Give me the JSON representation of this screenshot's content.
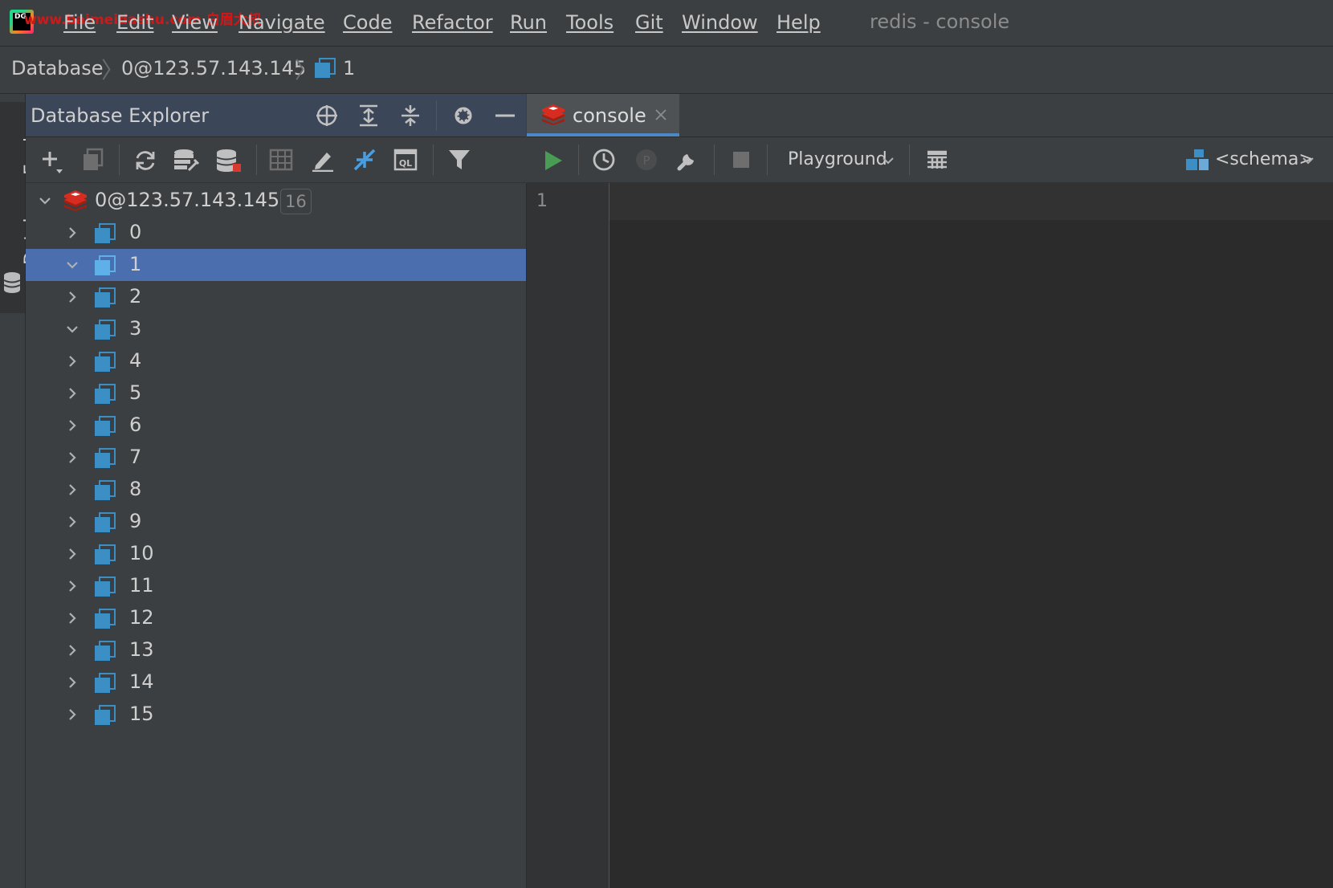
{
  "menubar": {
    "logo_text": "DG",
    "watermark": "www.baimeidashu.com 白眉大叔",
    "items": [
      "File",
      "Edit",
      "View",
      "Navigate",
      "Code",
      "Refactor",
      "Run",
      "Tools",
      "Git",
      "Window",
      "Help"
    ],
    "window_title": "redis - console"
  },
  "breadcrumb": {
    "items": [
      "Database",
      "0@123.57.143.145",
      "1"
    ]
  },
  "tool_stripe": {
    "label": "Database Explorer"
  },
  "explorer": {
    "title": "Database Explorer",
    "header_icons": [
      "crosshair-icon",
      "expand-all-icon",
      "collapse-all-icon",
      "gear-icon",
      "minimize-icon"
    ],
    "toolbar_icons": [
      "add-icon",
      "duplicate-icon",
      "refresh-icon",
      "data-source-properties-icon",
      "database-icon",
      "table-icon",
      "edit-icon",
      "jump-to-console-icon",
      "ql-console-icon",
      "filter-icon"
    ],
    "root": {
      "label": "0@123.57.143.145",
      "count": "16",
      "expanded": true
    },
    "databases": [
      {
        "label": "0",
        "expanded": false,
        "selected": false
      },
      {
        "label": "1",
        "expanded": true,
        "selected": true
      },
      {
        "label": "2",
        "expanded": false,
        "selected": false
      },
      {
        "label": "3",
        "expanded": true,
        "selected": false
      },
      {
        "label": "4",
        "expanded": false,
        "selected": false
      },
      {
        "label": "5",
        "expanded": false,
        "selected": false
      },
      {
        "label": "6",
        "expanded": false,
        "selected": false
      },
      {
        "label": "7",
        "expanded": false,
        "selected": false
      },
      {
        "label": "8",
        "expanded": false,
        "selected": false
      },
      {
        "label": "9",
        "expanded": false,
        "selected": false
      },
      {
        "label": "10",
        "expanded": false,
        "selected": false
      },
      {
        "label": "11",
        "expanded": false,
        "selected": false
      },
      {
        "label": "12",
        "expanded": false,
        "selected": false
      },
      {
        "label": "13",
        "expanded": false,
        "selected": false
      },
      {
        "label": "14",
        "expanded": false,
        "selected": false
      },
      {
        "label": "15",
        "expanded": false,
        "selected": false
      }
    ]
  },
  "editor": {
    "tab_label": "console",
    "playground_label": "Playground",
    "schema_label": "<schema>",
    "line_numbers": [
      "1"
    ],
    "toolbar_icons": [
      "run-icon",
      "history-icon",
      "transaction-p-icon",
      "settings-wrench-icon",
      "stop-icon",
      "table-view-icon",
      "schema-icon"
    ]
  },
  "colors": {
    "background": "#3c3f41",
    "editor_background": "#2b2b2b",
    "selection": "#4b6eaf",
    "accent_blue": "#4a88c7",
    "run_green": "#499c54",
    "redis_red": "#d82c20"
  }
}
